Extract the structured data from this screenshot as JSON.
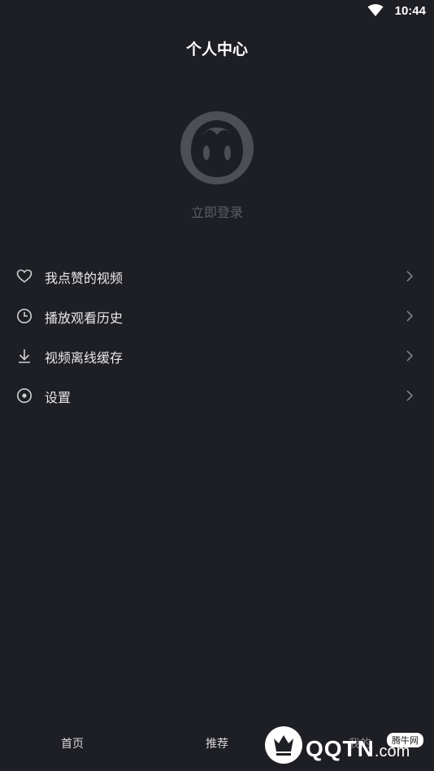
{
  "status_bar": {
    "time": "10:44",
    "wifi_icon": "wifi-icon"
  },
  "header": {
    "title": "个人中心"
  },
  "profile": {
    "avatar_icon": "avatar-icon",
    "login_text": "立即登录"
  },
  "menu": {
    "items": [
      {
        "label": "我点赞的视频",
        "icon": "heart-icon"
      },
      {
        "label": "播放观看历史",
        "icon": "clock-icon"
      },
      {
        "label": "视频离线缓存",
        "icon": "download-icon"
      },
      {
        "label": "设置",
        "icon": "settings-icon"
      }
    ]
  },
  "bottom_nav": {
    "tabs": [
      {
        "label": "首页"
      },
      {
        "label": "推荐"
      },
      {
        "label": "我的"
      }
    ]
  },
  "watermark": {
    "text": "QQTN",
    "suffix": ".com",
    "badge": "腾牛网"
  },
  "colors": {
    "background": "#1e1f24",
    "text_primary": "#ffffff",
    "text_muted": "#5c5e66",
    "avatar": "#4d4f57"
  }
}
